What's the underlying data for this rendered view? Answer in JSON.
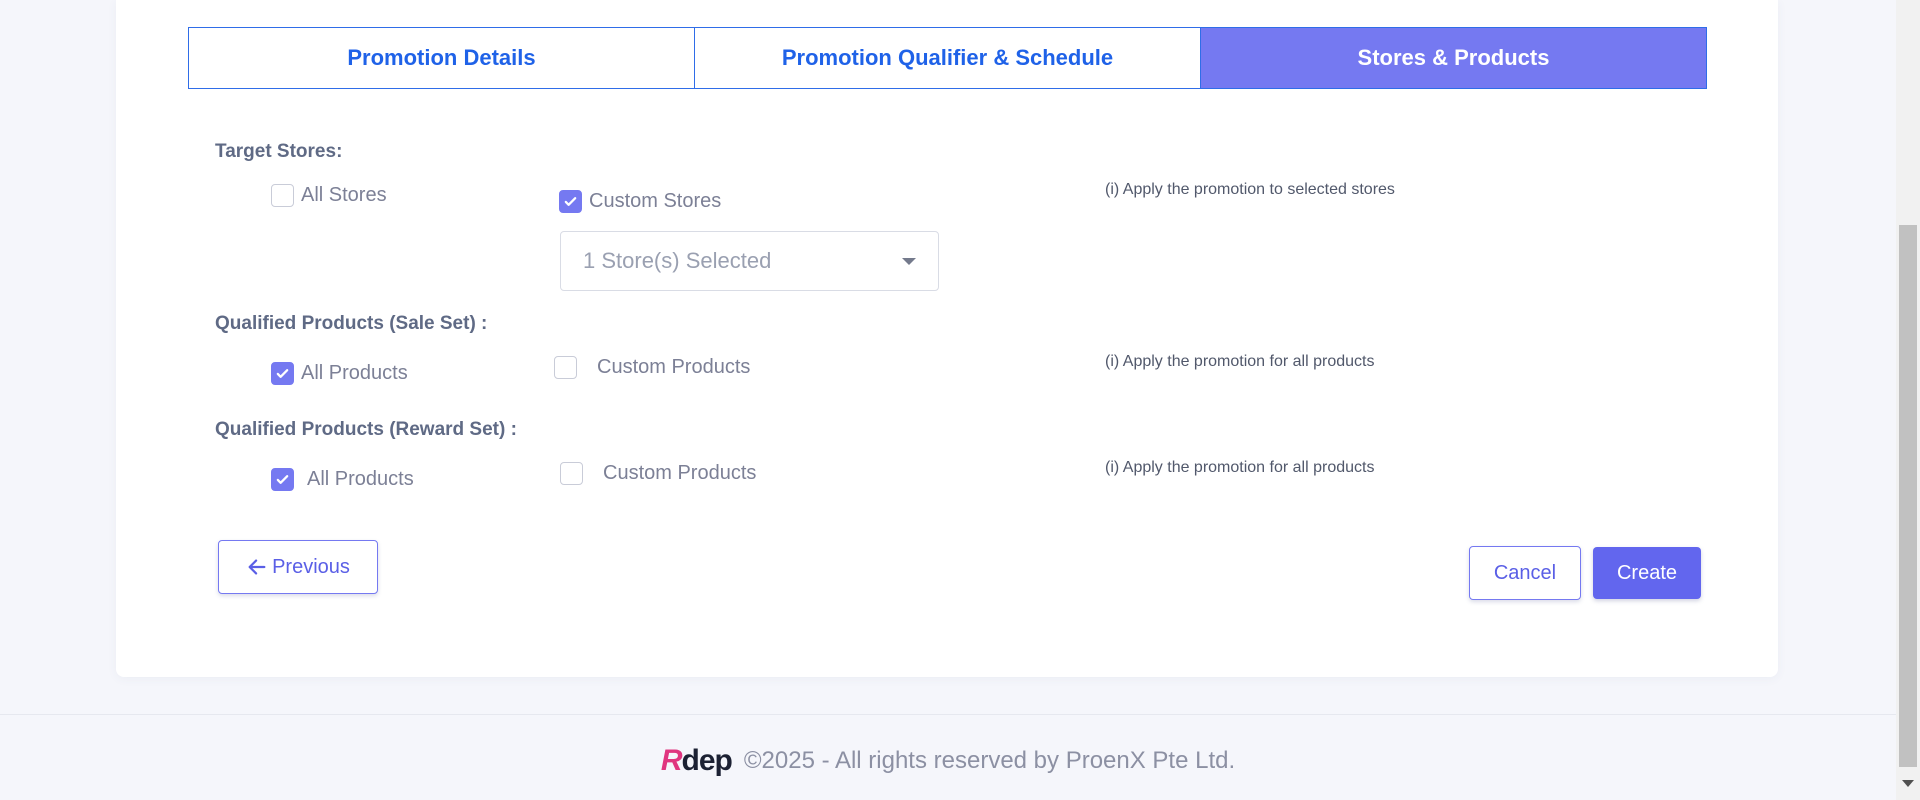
{
  "tabs": [
    {
      "label": "Promotion Details"
    },
    {
      "label": "Promotion Qualifier & Schedule"
    },
    {
      "label": "Stores & Products",
      "active": true
    }
  ],
  "target_stores": {
    "label": "Target Stores:",
    "all_stores": "All Stores",
    "custom_stores": "Custom Stores",
    "select_value": "1 Store(s) Selected",
    "hint": "(i) Apply the promotion to selected stores"
  },
  "sale_set": {
    "label": "Qualified Products (Sale Set) :",
    "all_products": "All Products",
    "custom_products": "Custom Products",
    "hint": "(i) Apply the promotion for all products"
  },
  "reward_set": {
    "label": "Qualified Products (Reward Set) :",
    "all_products": "All Products",
    "custom_products": "Custom Products",
    "hint": "(i) Apply the promotion for all products"
  },
  "actions": {
    "previous": "Previous",
    "cancel": "Cancel",
    "create": "Create"
  },
  "footer": {
    "logo_r": "R",
    "logo_text": "dep",
    "copyright": "©2025 - All rights reserved by ProenX Pte Ltd."
  },
  "colors": {
    "accent": "#7579f1",
    "primary_button": "#6266ee",
    "tab_text": "#1f62e8"
  }
}
